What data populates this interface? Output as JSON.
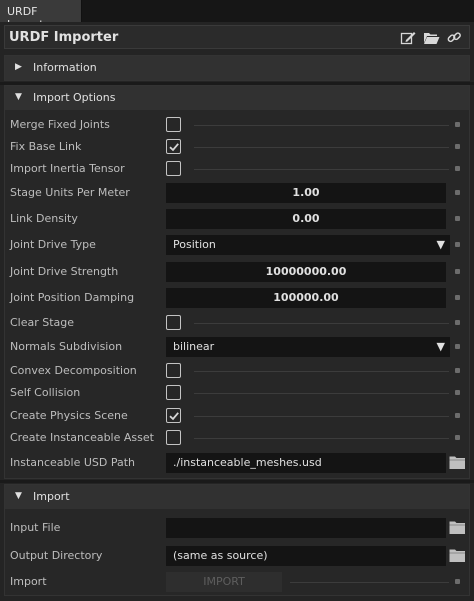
{
  "tab": {
    "label": "URDF Importer"
  },
  "window": {
    "title": "URDF Importer"
  },
  "sections": {
    "information": {
      "label": "Information"
    },
    "import_options": {
      "label": "Import Options"
    },
    "import": {
      "label": "Import"
    }
  },
  "options": {
    "merge_fixed_joints": {
      "label": "Merge Fixed Joints",
      "checked": false
    },
    "fix_base_link": {
      "label": "Fix Base Link",
      "checked": true
    },
    "import_inertia_tensor": {
      "label": "Import Inertia Tensor",
      "checked": false
    },
    "stage_units": {
      "label": "Stage Units Per Meter",
      "value": "1.00"
    },
    "link_density": {
      "label": "Link Density",
      "value": "0.00"
    },
    "joint_drive_type": {
      "label": "Joint Drive Type",
      "value": "Position"
    },
    "joint_drive_strength": {
      "label": "Joint Drive Strength",
      "value": "10000000.00"
    },
    "joint_position_damping": {
      "label": "Joint Position Damping",
      "value": "100000.00"
    },
    "clear_stage": {
      "label": "Clear Stage",
      "checked": false
    },
    "normals_subdivision": {
      "label": "Normals Subdivision",
      "value": "bilinear"
    },
    "convex_decomposition": {
      "label": "Convex Decomposition",
      "checked": false
    },
    "self_collision": {
      "label": "Self Collision",
      "checked": false
    },
    "create_physics_scene": {
      "label": "Create Physics Scene",
      "checked": true
    },
    "create_instanceable_asset": {
      "label": "Create Instanceable Asset",
      "checked": false
    },
    "instanceable_usd_path": {
      "label": "Instanceable USD Path",
      "value": "./instanceable_meshes.usd"
    }
  },
  "import_section": {
    "input_file": {
      "label": "Input File",
      "value": ""
    },
    "output_directory": {
      "label": "Output Directory",
      "value": "(same as source)"
    },
    "import_row": {
      "label": "Import",
      "button": "IMPORT"
    }
  },
  "icons": {
    "edit": "edit-icon",
    "folder": "folder-open-icon",
    "link": "link-icon",
    "expand": "triangle-right-icon",
    "collapse": "triangle-down-icon",
    "check": "checkmark-icon",
    "dropdown": "triangle-down-icon"
  },
  "colors": {
    "background": "#242424",
    "field": "#141414",
    "text": "#c8c8c8"
  }
}
